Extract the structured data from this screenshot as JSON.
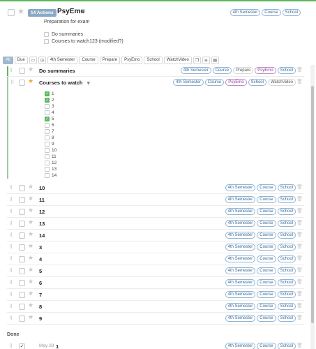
{
  "header": {
    "badge": "14 Actions",
    "title": "PsyEmo",
    "description": "Preparation for exam",
    "subtasks": [
      "Do summaries",
      "Courses to watch123 (modified?)"
    ],
    "tags": [
      "4th Semester",
      "Course",
      "School"
    ]
  },
  "filters": {
    "all": "All",
    "due": "Due",
    "tags": [
      "4th Semester",
      "Course",
      "Prepare",
      "PsyEmo",
      "School",
      "WatchVideo"
    ],
    "icons": [
      "screen-icon",
      "clock-icon",
      "copy-icon",
      "sliders-icon",
      "document-icon"
    ]
  },
  "tasks": {
    "do_summaries": {
      "title": "Do summaries",
      "tags": [
        "4th Semester",
        "Course",
        "Prepare",
        "PsyEmo",
        "School"
      ]
    },
    "courses": {
      "title": "Courses to watch",
      "tags": [
        "4th Semester",
        "Course",
        "PsyEmo",
        "School",
        "WatchVideo"
      ],
      "checklist": [
        {
          "label": "1",
          "done": true
        },
        {
          "label": "2",
          "done": true
        },
        {
          "label": "3",
          "done": false
        },
        {
          "label": "4",
          "done": false
        },
        {
          "label": "5",
          "done": true
        },
        {
          "label": "6",
          "done": false
        },
        {
          "label": "7",
          "done": false
        },
        {
          "label": "8",
          "done": false
        },
        {
          "label": "9",
          "done": false
        },
        {
          "label": "10",
          "done": false
        },
        {
          "label": "11",
          "done": false
        },
        {
          "label": "12",
          "done": false
        },
        {
          "label": "13",
          "done": false
        },
        {
          "label": "14",
          "done": false
        }
      ]
    },
    "rows": [
      "10",
      "11",
      "12",
      "13",
      "14",
      "3",
      "4",
      "5",
      "6",
      "7",
      "8",
      "9"
    ],
    "row_tags": [
      "4th Semester",
      "Course",
      "School"
    ]
  },
  "done": {
    "heading": "Done",
    "item": {
      "date": "May 28",
      "title": "1",
      "tags": [
        "4th Semester",
        "Course",
        "School"
      ]
    }
  },
  "colors": {
    "accent": "#5cb85c",
    "badge": "#8aa9c6",
    "star": "#f0a53a",
    "tag_purple": "#c38ac8"
  }
}
